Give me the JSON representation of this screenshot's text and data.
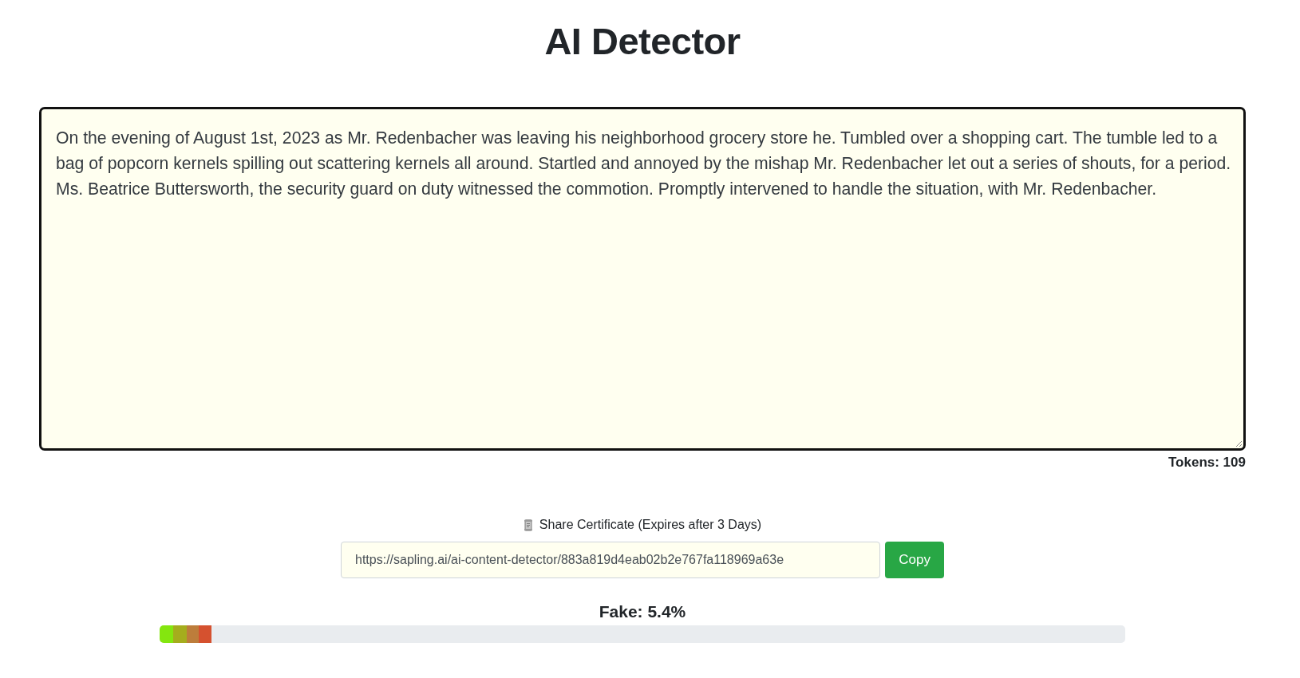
{
  "title": "AI Detector",
  "text_input": {
    "value": "On the evening of August 1st, 2023 as Mr. Redenbacher was leaving his neighborhood grocery store he. Tumbled over a shopping cart. The tumble led to a bag of popcorn kernels spilling out scattering kernels all around. Startled and annoyed by the mishap Mr. Redenbacher let out a series of shouts, for a period. Ms. Beatrice Buttersworth, the security guard on duty witnessed the commotion. Promptly intervened to handle the situation, with Mr. Redenbacher."
  },
  "tokens": "Tokens: 109",
  "share": {
    "label": "Share Certificate (Expires after 3 Days)",
    "url": "https://sapling.ai/ai-content-detector/883a819d4eab02b2e767fa118969a63e",
    "button": "Copy"
  },
  "result": {
    "label": "Fake: 5.4%",
    "level": 0.054
  }
}
